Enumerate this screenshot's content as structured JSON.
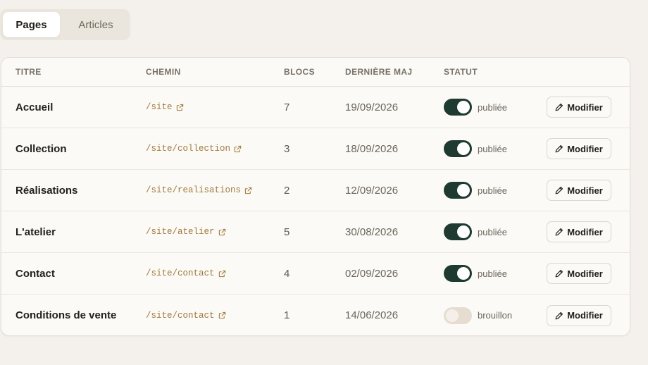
{
  "tabs": [
    {
      "label": "Pages",
      "active": true
    },
    {
      "label": "Articles",
      "active": false
    }
  ],
  "table": {
    "headers": {
      "title": "TITRE",
      "path": "CHEMIN",
      "blocks": "BLOCS",
      "updated": "DERNIÈRE MAJ",
      "status": "STATUT"
    },
    "rows": [
      {
        "title": "Accueil",
        "path": "/site",
        "blocks": "7",
        "updated": "19/09/2026",
        "published": true,
        "status": "publiée",
        "action": "Modifier"
      },
      {
        "title": "Collection",
        "path": "/site/collection",
        "blocks": "3",
        "updated": "18/09/2026",
        "published": true,
        "status": "publiée",
        "action": "Modifier"
      },
      {
        "title": "Réalisations",
        "path": "/site/realisations",
        "blocks": "2",
        "updated": "12/09/2026",
        "published": true,
        "status": "publiée",
        "action": "Modifier"
      },
      {
        "title": "L'atelier",
        "path": "/site/atelier",
        "blocks": "5",
        "updated": "30/08/2026",
        "published": true,
        "status": "publiée",
        "action": "Modifier"
      },
      {
        "title": "Contact",
        "path": "/site/contact",
        "blocks": "4",
        "updated": "02/09/2026",
        "published": true,
        "status": "publiée",
        "action": "Modifier"
      },
      {
        "title": "Conditions de vente",
        "path": "/site/contact",
        "blocks": "1",
        "updated": "14/06/2026",
        "published": false,
        "status": "brouillon",
        "action": "Modifier"
      }
    ]
  },
  "icons": {
    "path_link": "external-link-icon",
    "edit": "pencil-icon"
  },
  "colors": {
    "background": "#f4f1ec",
    "toggle_on": "#1f3a30",
    "toggle_off": "#e6ddd0",
    "path_text": "#a07a3a"
  }
}
